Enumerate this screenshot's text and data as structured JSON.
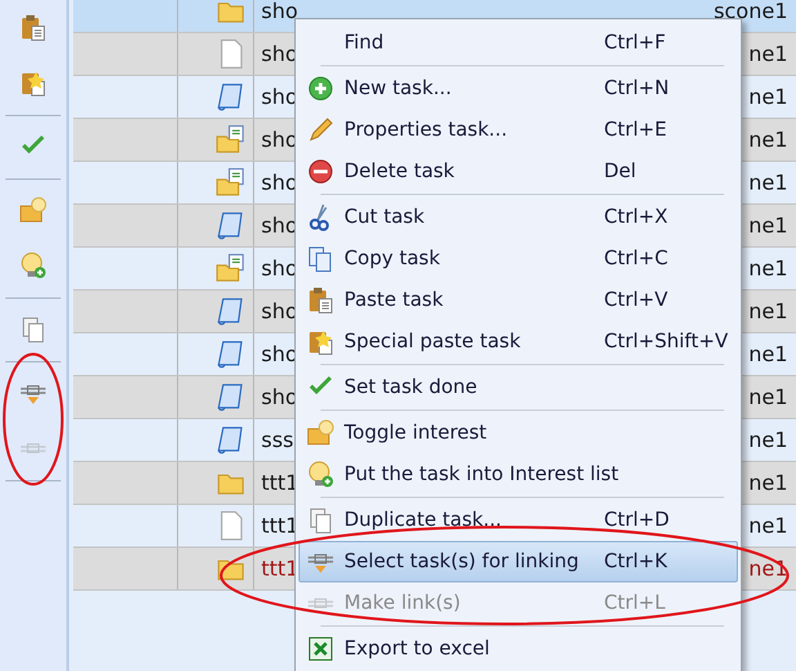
{
  "toolbar": [
    {
      "disabled": false
    },
    {
      "disabled": false
    },
    {
      "kind": "separator"
    },
    {
      "disabled": false
    },
    {
      "kind": "separator"
    },
    {
      "disabled": false
    },
    {
      "disabled": false
    },
    {
      "kind": "separator"
    },
    {
      "disabled": false
    },
    {
      "kind": "separator"
    },
    {
      "disabled": false
    },
    {
      "disabled": true
    },
    {
      "kind": "separator"
    }
  ],
  "table": {
    "rows": [
      {
        "kind": "folder",
        "name": "sho",
        "column_4": "scone1",
        "selected": true,
        "color": "#1a1a1a"
      },
      {
        "kind": "page",
        "name": "sho",
        "column_4": "ne1",
        "selected": false,
        "color": "#1a1a1a"
      },
      {
        "kind": "scroll",
        "name": "sho",
        "column_4": "ne1",
        "selected": false,
        "color": "#1a1a1a"
      },
      {
        "kind": "folderdoc",
        "name": "sho",
        "column_4": "ne1",
        "selected": false,
        "color": "#1a1a1a"
      },
      {
        "kind": "folderdoc",
        "name": "sho",
        "column_4": "ne1",
        "selected": false,
        "color": "#1a1a1a"
      },
      {
        "kind": "scroll",
        "name": "sho",
        "column_4": "ne1",
        "selected": false,
        "color": "#1a1a1a"
      },
      {
        "kind": "folderdoc",
        "name": "sho",
        "column_4": "ne1",
        "selected": false,
        "color": "#1a1a1a"
      },
      {
        "kind": "scroll",
        "name": "sho",
        "column_4": "ne1",
        "selected": false,
        "color": "#1a1a1a"
      },
      {
        "kind": "scroll",
        "name": "sho",
        "column_4": "ne1",
        "selected": false,
        "color": "#1a1a1a"
      },
      {
        "kind": "scroll",
        "name": "sho",
        "column_4": "ne1",
        "selected": false,
        "color": "#1a1a1a"
      },
      {
        "kind": "scroll",
        "name": "sss",
        "column_4": "ne1",
        "selected": false,
        "color": "#1a1a1a"
      },
      {
        "kind": "folder",
        "name": "ttt1",
        "column_4": "ne1",
        "selected": false,
        "color": "#1a1a1a"
      },
      {
        "kind": "page",
        "name": "ttt1",
        "column_4": "ne1",
        "selected": false,
        "color": "#1a1a1a"
      },
      {
        "kind": "folder",
        "name": "ttt1",
        "column_4": "ne1",
        "selected": false,
        "color": "#a01818"
      }
    ]
  },
  "context_menu": [
    {
      "kind": "item",
      "label": "Find",
      "shortcut": "Ctrl+F",
      "selected": false,
      "disabled": false
    },
    {
      "kind": "separator"
    },
    {
      "kind": "item",
      "label": "New task...",
      "shortcut": "Ctrl+N",
      "selected": false,
      "disabled": false
    },
    {
      "kind": "item",
      "label": "Properties task...",
      "shortcut": "Ctrl+E",
      "selected": false,
      "disabled": false
    },
    {
      "kind": "item",
      "label": "Delete task",
      "shortcut": "Del",
      "selected": false,
      "disabled": false
    },
    {
      "kind": "separator"
    },
    {
      "kind": "item",
      "label": "Cut task",
      "shortcut": "Ctrl+X",
      "selected": false,
      "disabled": false
    },
    {
      "kind": "item",
      "label": "Copy task",
      "shortcut": "Ctrl+C",
      "selected": false,
      "disabled": false
    },
    {
      "kind": "item",
      "label": "Paste task",
      "shortcut": "Ctrl+V",
      "selected": false,
      "disabled": false
    },
    {
      "kind": "item",
      "label": "Special paste task",
      "shortcut": "Ctrl+Shift+V",
      "selected": false,
      "disabled": false
    },
    {
      "kind": "separator"
    },
    {
      "kind": "item",
      "label": "Set task done",
      "selected": false,
      "disabled": false
    },
    {
      "kind": "separator"
    },
    {
      "kind": "item",
      "label": "Toggle interest",
      "selected": false,
      "disabled": false
    },
    {
      "kind": "item",
      "label": "Put the task into Interest list",
      "selected": false,
      "disabled": false
    },
    {
      "kind": "separator"
    },
    {
      "kind": "item",
      "label": "Duplicate task...",
      "shortcut": "Ctrl+D",
      "selected": false,
      "disabled": false
    },
    {
      "kind": "item",
      "label": "Select task(s) for linking",
      "shortcut": "Ctrl+K",
      "selected": true,
      "disabled": false
    },
    {
      "kind": "item",
      "label": "Make link(s)",
      "shortcut": "Ctrl+L",
      "selected": false,
      "disabled": true
    },
    {
      "kind": "separator"
    },
    {
      "kind": "item",
      "label": "Export to excel",
      "selected": false,
      "disabled": false
    }
  ],
  "annotations": [
    {
      "kind": "ellipse",
      "color": "#e0161b"
    },
    {
      "kind": "ellipse",
      "color": "#e0161b"
    }
  ]
}
